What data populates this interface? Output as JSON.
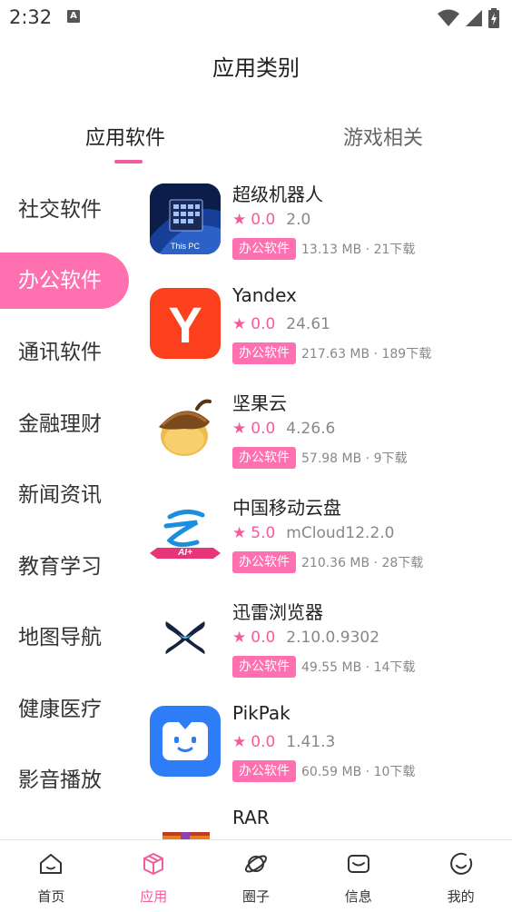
{
  "status": {
    "time": "2:32",
    "indicator": "A"
  },
  "title": "应用类别",
  "tabs": [
    {
      "label": "应用软件",
      "active": true
    },
    {
      "label": "游戏相关",
      "active": false
    }
  ],
  "categories": [
    {
      "label": "社交软件",
      "active": false
    },
    {
      "label": "办公软件",
      "active": true
    },
    {
      "label": "通讯软件",
      "active": false
    },
    {
      "label": "金融理财",
      "active": false
    },
    {
      "label": "新闻资讯",
      "active": false
    },
    {
      "label": "教育学习",
      "active": false
    },
    {
      "label": "地图导航",
      "active": false
    },
    {
      "label": "健康医疗",
      "active": false
    },
    {
      "label": "影音播放",
      "active": false
    }
  ],
  "apps": [
    {
      "name": "超级机器人",
      "rating": "0.0",
      "version": "2.0",
      "tag": "办公软件",
      "meta": "13.13 MB · 21下载",
      "icon": "windows-pc-icon",
      "icon_text": "This PC"
    },
    {
      "name": "Yandex",
      "rating": "0.0",
      "version": "24.61",
      "tag": "办公软件",
      "meta": "217.63 MB · 189下载",
      "icon": "yandex-icon",
      "icon_text": "Y"
    },
    {
      "name": "坚果云",
      "rating": "0.0",
      "version": "4.26.6",
      "tag": "办公软件",
      "meta": "57.98 MB · 9下载",
      "icon": "acorn-icon"
    },
    {
      "name": "中国移动云盘",
      "rating": "5.0",
      "version": "mCloud12.2.0",
      "tag": "办公软件",
      "meta": "210.36 MB · 28下载",
      "icon": "mcloud-icon",
      "icon_text": "AI+"
    },
    {
      "name": "迅雷浏览器",
      "rating": "0.0",
      "version": "2.10.0.9302",
      "tag": "办公软件",
      "meta": "49.55 MB · 14下载",
      "icon": "xunlei-icon"
    },
    {
      "name": "PikPak",
      "rating": "0.0",
      "version": "1.41.3",
      "tag": "办公软件",
      "meta": "60.59 MB · 10下载",
      "icon": "pikpak-icon"
    },
    {
      "name": "RAR",
      "rating": "",
      "version": "",
      "tag": "",
      "meta": "",
      "icon": "rar-icon"
    }
  ],
  "nav": [
    {
      "label": "首页",
      "icon": "home-icon",
      "active": false
    },
    {
      "label": "应用",
      "icon": "apps-cube-icon",
      "active": true
    },
    {
      "label": "圈子",
      "icon": "planet-icon",
      "active": false
    },
    {
      "label": "信息",
      "icon": "message-icon",
      "active": false
    },
    {
      "label": "我的",
      "icon": "profile-smile-icon",
      "active": false
    }
  ],
  "colors": {
    "accent": "#ff70b0",
    "accent_text": "#f25c9c"
  }
}
